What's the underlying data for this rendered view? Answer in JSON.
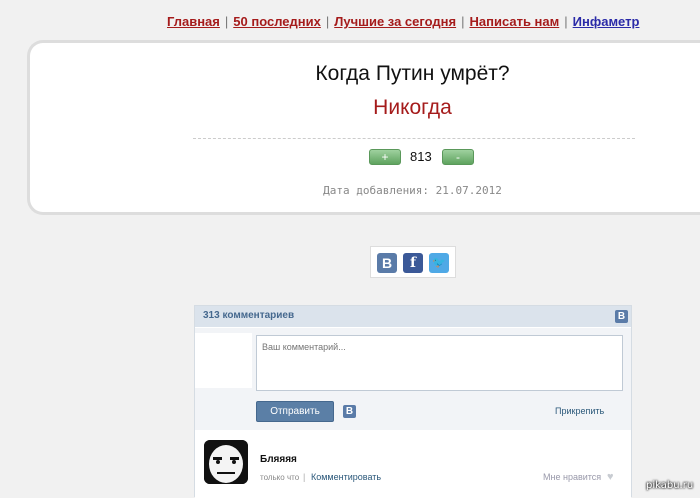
{
  "nav": {
    "items": [
      "Главная",
      "50 последних",
      "Лучшие за сегодня",
      "Написать нам",
      "Инфаметр"
    ],
    "separator": "|"
  },
  "quote": {
    "question": "Когда Путин умрёт?",
    "answer": "Никогда",
    "plus_label": "+",
    "minus_label": "-",
    "score": "813",
    "date": "Дата добавления: 21.07.2012"
  },
  "share": {
    "icons": [
      "vk-icon",
      "facebook-icon",
      "twitter-icon"
    ],
    "vk_letter": "B",
    "fb_letter": "f",
    "tw_glyph": "🐦"
  },
  "comments": {
    "count_label": "313 комментариев",
    "vk_badge": "B",
    "placeholder": "Ваш комментарий...",
    "send_label": "Отправить",
    "attach_label": "Прикрепить",
    "items": [
      {
        "author": "Бляяяя",
        "time": "только что",
        "separator": "|",
        "reply_label": "Комментировать",
        "like_label": "Мне нравится",
        "heart": "♥"
      }
    ]
  },
  "watermark": "pikabu.ru",
  "colors": {
    "accent_red": "#a51b1b",
    "vk_blue": "#45688e",
    "vote_green": "#5fa35f"
  }
}
